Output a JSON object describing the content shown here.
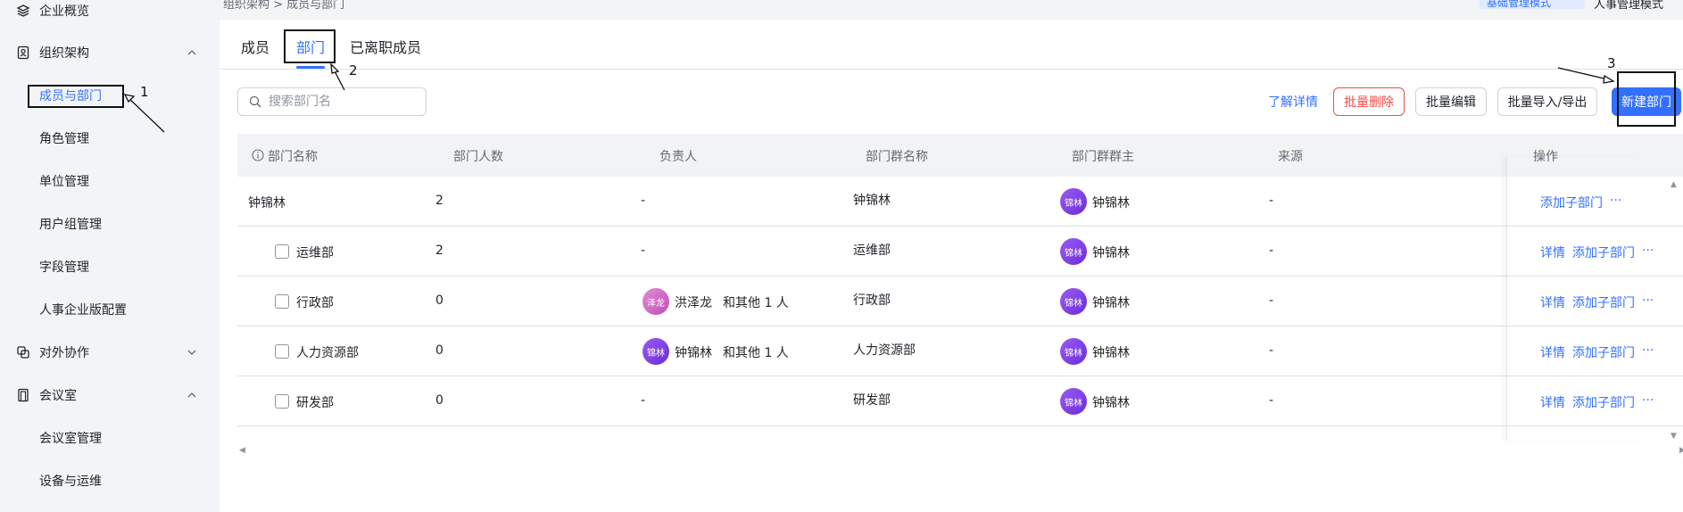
{
  "sidebar": {
    "items": [
      {
        "label": "企业概览",
        "icon": "layers-icon"
      },
      {
        "label": "组织架构",
        "icon": "contacts-icon",
        "expanded": true
      },
      {
        "label": "成员与部门",
        "active": true
      },
      {
        "label": "角色管理"
      },
      {
        "label": "单位管理"
      },
      {
        "label": "用户组管理"
      },
      {
        "label": "字段管理"
      },
      {
        "label": "人事企业版配置"
      },
      {
        "label": "对外协作",
        "icon": "share-icon",
        "expanded": false
      },
      {
        "label": "会议室",
        "icon": "door-icon",
        "expanded": true
      },
      {
        "label": "会议室管理"
      },
      {
        "label": "设备与运维"
      }
    ]
  },
  "topbar": {
    "breadcrumb": "组织架构  >  成员与部门",
    "mode_button": "基础管理模式",
    "mode_link": "人事管理模式"
  },
  "tabs": [
    {
      "label": "成员"
    },
    {
      "label": "部门",
      "active": true
    },
    {
      "label": "已离职成员"
    }
  ],
  "search": {
    "placeholder": "搜索部门名"
  },
  "toolbar": {
    "learn_more": "了解详情",
    "batch_delete": "批量删除",
    "batch_edit": "批量编辑",
    "batch_import_export": "批量导入/导出",
    "new_department": "新建部门"
  },
  "table": {
    "headers": [
      "部门名称",
      "部门人数",
      "负责人",
      "部门群名称",
      "部门群群主",
      "来源",
      "操作"
    ],
    "rows": [
      {
        "name": "钟锦林",
        "count": "2",
        "leader": "-",
        "leader_extra": "",
        "group": "钟锦林",
        "owner": "钟锦林",
        "owner_avatar": "锦林",
        "source": "-",
        "ops": [
          "添加子部门"
        ]
      },
      {
        "name": "运维部",
        "count": "2",
        "leader": "-",
        "leader_extra": "",
        "group": "运维部",
        "owner": "钟锦林",
        "owner_avatar": "锦林",
        "source": "-",
        "ops": [
          "详情",
          "添加子部门"
        ]
      },
      {
        "name": "行政部",
        "count": "0",
        "leader": "洪泽龙",
        "leader_avatar": "泽龙",
        "leader_extra": "和其他 1 人",
        "group": "行政部",
        "owner": "钟锦林",
        "owner_avatar": "锦林",
        "source": "-",
        "ops": [
          "详情",
          "添加子部门"
        ]
      },
      {
        "name": "人力资源部",
        "count": "0",
        "leader": "钟锦林",
        "leader_avatar": "锦林",
        "leader_extra": "和其他 1 人",
        "group": "人力资源部",
        "owner": "钟锦林",
        "owner_avatar": "锦林",
        "source": "-",
        "ops": [
          "详情",
          "添加子部门"
        ]
      },
      {
        "name": "研发部",
        "count": "0",
        "leader": "-",
        "leader_extra": "",
        "group": "研发部",
        "owner": "钟锦林",
        "owner_avatar": "锦林",
        "source": "-",
        "ops": [
          "详情",
          "添加子部门"
        ]
      }
    ],
    "more_glyph": "···"
  },
  "annotations": [
    "1",
    "2",
    "3"
  ],
  "colors": {
    "accent": "#3370ff",
    "danger": "#f54a45",
    "sidebar_bg": "#f3f4f6"
  }
}
